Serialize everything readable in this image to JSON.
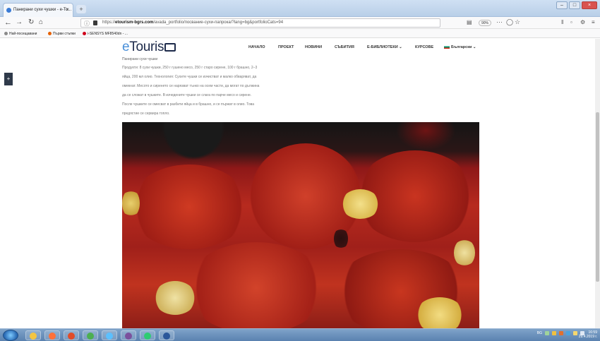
{
  "browser": {
    "tab_title": "Панирани сухи чушки - e-To...",
    "tab_close": "×",
    "new_tab": "+",
    "window_controls": [
      "–",
      "□",
      "×"
    ],
    "url_prefix": "https://",
    "url_domain": "etourism-bgrs.com",
    "url_rest": "/avada_portfolio/посвание-сухи-папрока/?lang=bg&portfolioCats=94",
    "zoom_level": "90%",
    "more_label": "···",
    "back_icon": "back-arrow-icon",
    "forward_icon": "forward-arrow-icon",
    "reload_icon": "reload-icon",
    "home_icon": "home-icon"
  },
  "bookmarks": [
    {
      "label": "Най-посещавани",
      "color": "#f2a900"
    },
    {
      "label": "Първи стъпки",
      "color": "#e66000"
    },
    {
      "label": "i-SENSYS MF8540dn - ...",
      "color": "#d0021b"
    }
  ],
  "site": {
    "logo_e": "e",
    "logo_rest": "Touris",
    "menu": [
      "НАЧАЛО",
      "ПРОЕКТ",
      "НОВИНИ",
      "СЪБИТИЯ",
      "Е-БИБЛИОТЕКИ ⌄",
      "КУРСОВЕ",
      "Български ⌄"
    ],
    "sidebar_toggle": "+"
  },
  "article": {
    "title": "Панирани сухи чушки",
    "lines": [
      "Продукти: 8 сухи чушки, 250 г гушено месо, 250 г старо сирене, 100 г брашно, 2–3",
      "яйца, 200 мл олио. Технология: Сухите чушки се изчистват и малко обваряват, да",
      "омекнат. Месото и сиренето се нарязват тънко на осем части, да могат по дължина",
      "да се сложат в чушките. В изчедените чушки се слага по парче месо и сирене.",
      "После чушките се омесват в разбити яйца и в брашно, и се пържат в олио. Това",
      "предястие се сервира топло."
    ]
  },
  "taskbar": {
    "apps": [
      {
        "name": "explorer",
        "color": "#f4c542"
      },
      {
        "name": "firefox",
        "color": "#ff7139"
      },
      {
        "name": "media",
        "color": "#e24c29"
      },
      {
        "name": "chrome",
        "color": "#4caf50"
      },
      {
        "name": "ie",
        "color": "#5bc0ff"
      },
      {
        "name": "viber",
        "color": "#7b519d"
      },
      {
        "name": "opera",
        "color": "#2ecc71"
      },
      {
        "name": "word",
        "color": "#2b579a"
      }
    ],
    "lang": "BG",
    "time": "16:59",
    "date": "29.4.2019 г."
  }
}
